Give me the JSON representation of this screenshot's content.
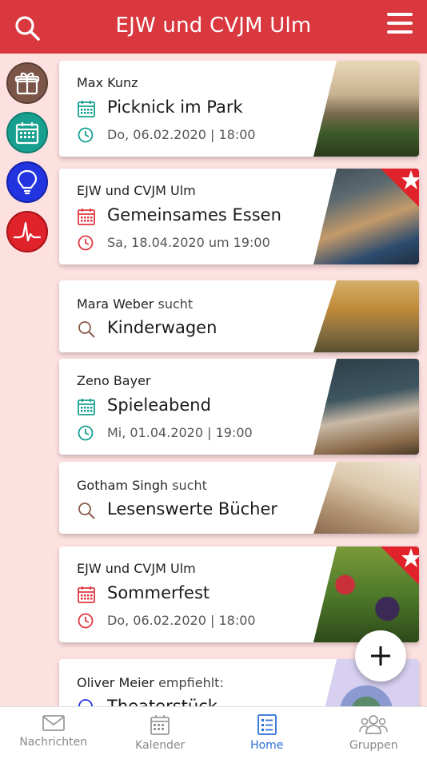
{
  "header": {
    "title": "EJW und CVJM Ulm"
  },
  "colors": {
    "brand": "#d9383f",
    "teal": "#17a08f",
    "red": "#e0383f",
    "brown": "#8a5a4a",
    "blue": "#2a6fd6"
  },
  "sidebar": {
    "icons": [
      "gift-icon",
      "calendar-icon",
      "lightbulb-icon",
      "heartbeat-icon"
    ]
  },
  "cards": [
    {
      "author": "Max Kunz",
      "title": "Picknick im Park",
      "date": "Do, 06.02.2020 | 18:00"
    },
    {
      "author": "EJW und CVJM Ulm",
      "title": "Gemeinsames Essen",
      "date": "Sa, 18.04.2020 um 19:00"
    },
    {
      "author": "Mara Weber",
      "verb": "sucht",
      "title": "Kinderwagen"
    },
    {
      "author": "Zeno Bayer",
      "title": "Spieleabend",
      "date": "Mi, 01.04.2020 | 19:00"
    },
    {
      "author": "Gotham Singh",
      "verb": "sucht",
      "title": "Lesenswerte Bücher"
    },
    {
      "author": "EJW und CVJM Ulm",
      "title": "Sommerfest",
      "date": "Do, 06.02.2020 | 18:00"
    },
    {
      "author": "Oliver Meier",
      "verb": "empfiehlt:",
      "title": "Theaterstück"
    }
  ],
  "tabs": [
    {
      "label": "Nachrichten"
    },
    {
      "label": "Kalender"
    },
    {
      "label": "Home"
    },
    {
      "label": "Gruppen"
    }
  ]
}
